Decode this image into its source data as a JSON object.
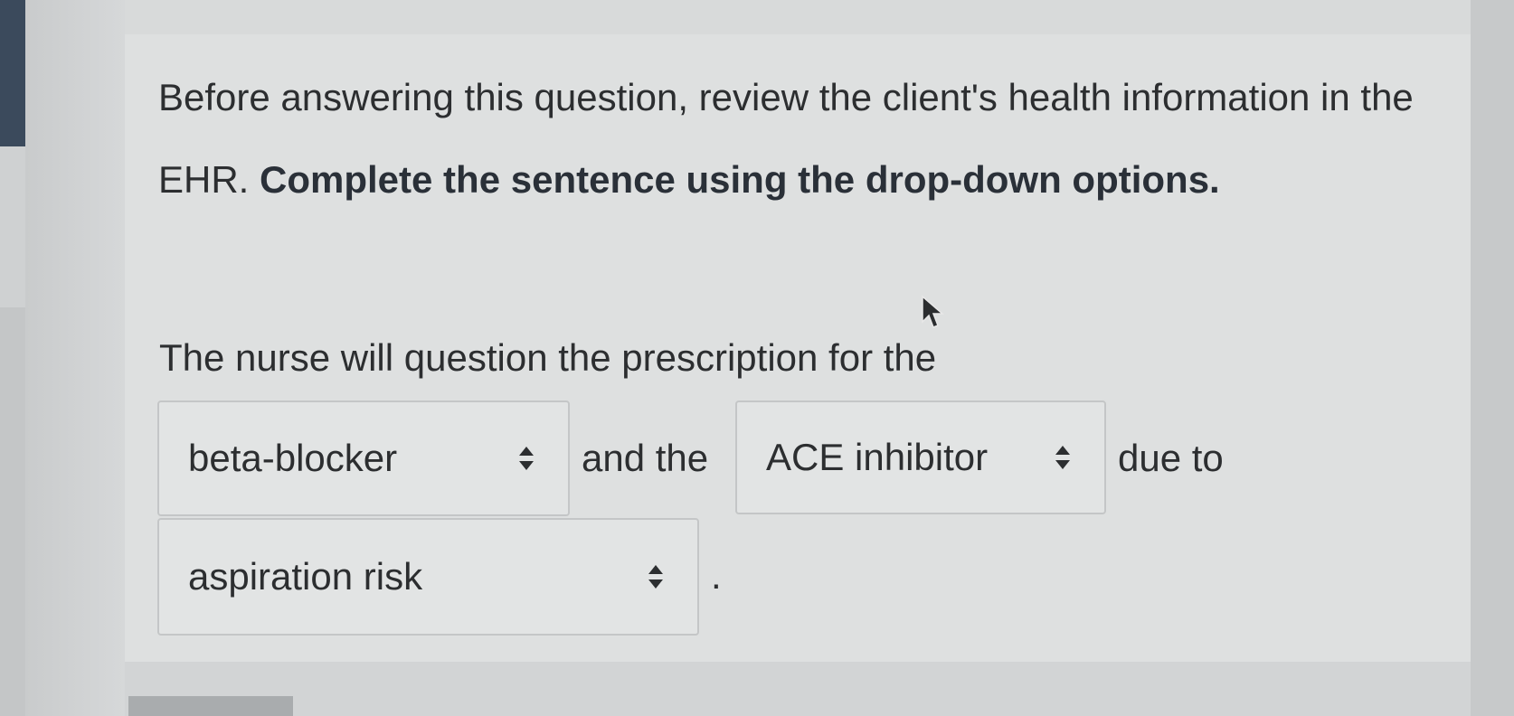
{
  "instructions": {
    "text_plain": "Before answering this question, review the client's health information in the EHR.",
    "text_bold": "Complete the sentence using the drop-down options."
  },
  "question": {
    "stem": "The nurse will question the prescription for the",
    "dropdown_1": {
      "selected": "beta-blocker"
    },
    "connector_1": "and the",
    "dropdown_2": {
      "selected": "ACE inhibitor"
    },
    "connector_2": "due to",
    "dropdown_3": {
      "selected": "aspiration risk"
    },
    "terminal_punctuation": "."
  },
  "icons": {
    "dropdown_arrows": "sort-updown-icon",
    "cursor": "mouse-pointer-icon"
  },
  "colors": {
    "background": "#dee0e0",
    "text": "#2c2e30",
    "dropdown_border": "#c4c6c7"
  }
}
